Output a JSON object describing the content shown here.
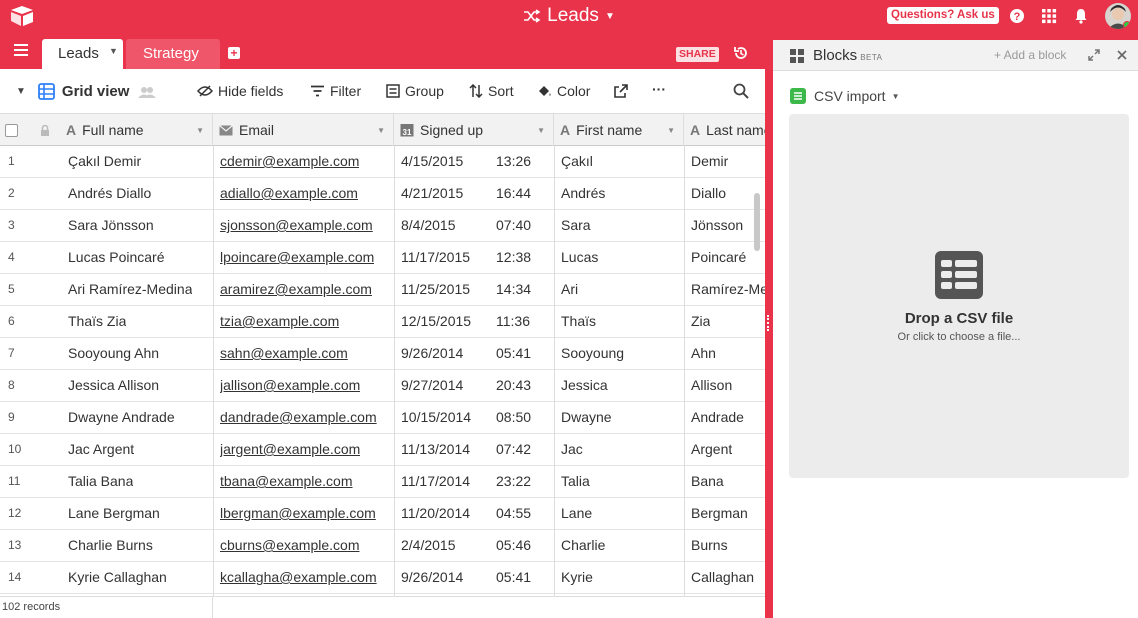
{
  "topbar": {
    "base_name": "Leads",
    "help_label": "Questions? Ask us"
  },
  "tabs": {
    "active": "Leads",
    "other": "Strategy",
    "share_label": "SHARE"
  },
  "toolbar": {
    "view_name": "Grid view",
    "hide_fields": "Hide fields",
    "filter": "Filter",
    "group": "Group",
    "sort": "Sort",
    "color": "Color",
    "more": "···"
  },
  "columns": [
    "Full name",
    "Email",
    "Signed up",
    "First name",
    "Last name"
  ],
  "rows": [
    {
      "n": "1",
      "full": "Çakıl Demir",
      "email": "cdemir@example.com",
      "date": "4/15/2015",
      "time": "13:26",
      "first": "Çakıl",
      "last": "Demir"
    },
    {
      "n": "2",
      "full": "Andrés Diallo",
      "email": "adiallo@example.com",
      "date": "4/21/2015",
      "time": "16:44",
      "first": "Andrés",
      "last": "Diallo"
    },
    {
      "n": "3",
      "full": "Sara Jönsson",
      "email": "sjonsson@example.com",
      "date": "8/4/2015",
      "time": "07:40",
      "first": "Sara",
      "last": "Jönsson"
    },
    {
      "n": "4",
      "full": "Lucas Poincaré",
      "email": "lpoincare@example.com",
      "date": "11/17/2015",
      "time": "12:38",
      "first": "Lucas",
      "last": "Poincaré"
    },
    {
      "n": "5",
      "full": "Ari Ramírez-Medina",
      "email": "aramirez@example.com",
      "date": "11/25/2015",
      "time": "14:34",
      "first": "Ari",
      "last": "Ramírez-Medina"
    },
    {
      "n": "6",
      "full": "Thaïs Zia",
      "email": "tzia@example.com",
      "date": "12/15/2015",
      "time": "11:36",
      "first": "Thaïs",
      "last": "Zia"
    },
    {
      "n": "7",
      "full": "Sooyoung Ahn",
      "email": "sahn@example.com",
      "date": "9/26/2014",
      "time": "05:41",
      "first": "Sooyoung",
      "last": "Ahn"
    },
    {
      "n": "8",
      "full": "Jessica Allison",
      "email": "jallison@example.com",
      "date": "9/27/2014",
      "time": "20:43",
      "first": "Jessica",
      "last": "Allison"
    },
    {
      "n": "9",
      "full": "Dwayne Andrade",
      "email": "dandrade@example.com",
      "date": "10/15/2014",
      "time": "08:50",
      "first": "Dwayne",
      "last": "Andrade"
    },
    {
      "n": "10",
      "full": "Jac Argent",
      "email": "jargent@example.com",
      "date": "11/13/2014",
      "time": "07:42",
      "first": "Jac",
      "last": "Argent"
    },
    {
      "n": "11",
      "full": "Talia Bana",
      "email": "tbana@example.com",
      "date": "11/17/2014",
      "time": "23:22",
      "first": "Talia",
      "last": "Bana"
    },
    {
      "n": "12",
      "full": "Lane Bergman",
      "email": "lbergman@example.com",
      "date": "11/20/2014",
      "time": "04:55",
      "first": "Lane",
      "last": "Bergman"
    },
    {
      "n": "13",
      "full": "Charlie Burns",
      "email": "cburns@example.com",
      "date": "2/4/2015",
      "time": "05:46",
      "first": "Charlie",
      "last": "Burns"
    },
    {
      "n": "14",
      "full": "Kyrie Callaghan",
      "email": "kcallagha@example.com",
      "date": "9/26/2014",
      "time": "05:41",
      "first": "Kyrie",
      "last": "Callaghan"
    }
  ],
  "record_count": "102 records",
  "blocks": {
    "title": "Blocks",
    "beta": "BETA",
    "add_block": "+ Add a block",
    "block_name": "CSV import",
    "drop_title": "Drop a CSV file",
    "drop_sub": "Or click to choose a file..."
  },
  "colors": {
    "brand": "#e8334a",
    "csv_badge": "#3cb94a",
    "view_icon": "#2d7ff9"
  }
}
